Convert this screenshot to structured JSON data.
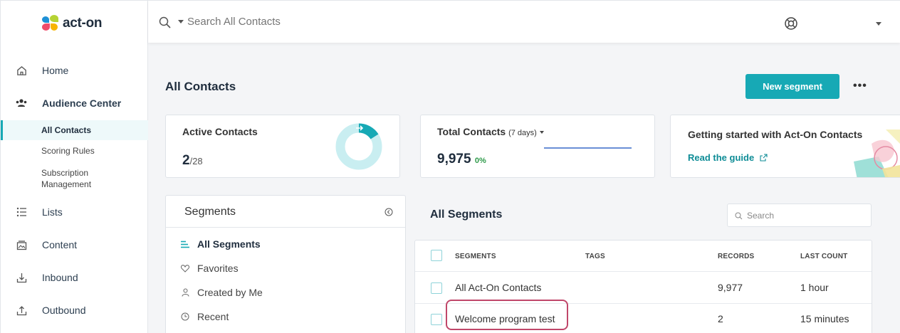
{
  "brand": {
    "name": "act-on"
  },
  "nav": {
    "home": "Home",
    "audience_center": "Audience Center",
    "sub": [
      "All Contacts",
      "Scoring Rules",
      "Subscription",
      "Management"
    ],
    "lists": "Lists",
    "content": "Content",
    "inbound": "Inbound",
    "outbound": "Outbound"
  },
  "topbar": {
    "search_placeholder": "Search All Contacts"
  },
  "page": {
    "title": "All Contacts",
    "new_segment": "New segment",
    "more": "•••"
  },
  "cards": {
    "active": {
      "title": "Active Contacts",
      "value": "2",
      "total": "/28"
    },
    "total": {
      "title": "Total Contacts",
      "period": "(7 days)",
      "value": "9,975",
      "change": "0%"
    },
    "guide": {
      "title": "Getting started with Act-On Contacts",
      "link": "Read the guide"
    }
  },
  "segments_panel": {
    "title": "Segments",
    "items": [
      "All Segments",
      "Favorites",
      "Created by Me",
      "Recent"
    ]
  },
  "all_segments": {
    "title": "All Segments",
    "search_placeholder": "Search",
    "columns": [
      "SEGMENTS",
      "TAGS",
      "RECORDS",
      "LAST COUNT"
    ],
    "rows": [
      {
        "name": "All Act-On Contacts",
        "records": "9,977",
        "last_count": "1 hour"
      },
      {
        "name": "Welcome program test",
        "records": "2",
        "last_count": "15 minutes"
      }
    ]
  },
  "colors": {
    "accent": "#17a9b5",
    "highlight": "#c0476a"
  }
}
